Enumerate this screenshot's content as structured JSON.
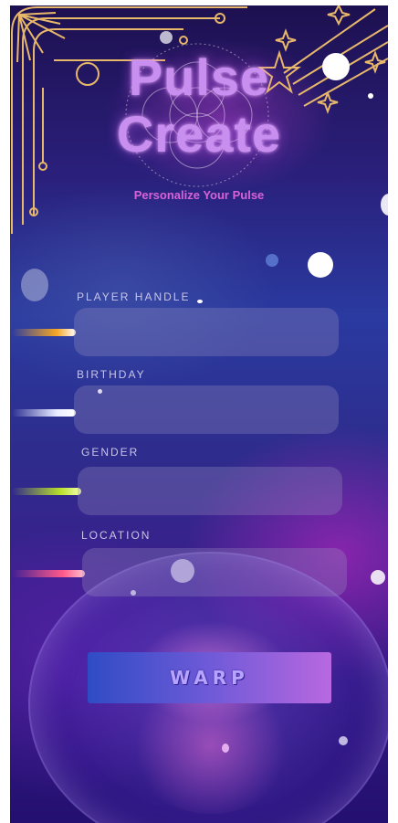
{
  "app": {
    "title_line1": "Pulse",
    "title_line2": "Create",
    "subtitle": "Personalize Your Pulse"
  },
  "form": {
    "fields": [
      {
        "label": "PLAYER HANDLE",
        "value": "",
        "streak_color": "#f5a623"
      },
      {
        "label": "BIRTHDAY",
        "value": "",
        "streak_color": "#e8ecff"
      },
      {
        "label": "GENDER",
        "value": "",
        "streak_color": "#b8e02a"
      },
      {
        "label": "LOCATION",
        "value": "",
        "streak_color": "#ff5a8a"
      }
    ],
    "submit_label": "WARP"
  },
  "theme": {
    "ornament_color": "#e8b86a",
    "title_color": "#c98ff0",
    "subtitle_color": "#d862d8",
    "button_gradient": [
      "#2f4cc4",
      "#b868e0"
    ]
  }
}
